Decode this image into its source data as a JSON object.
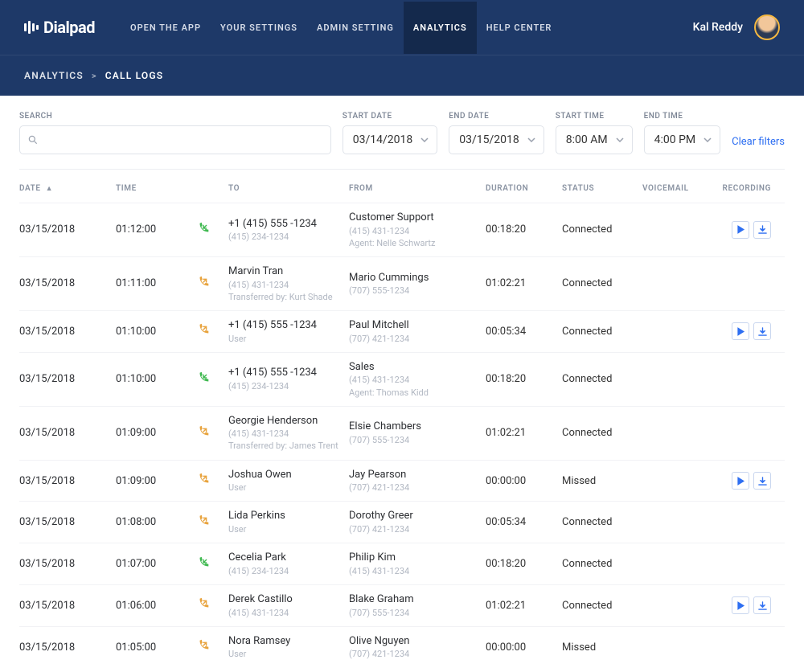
{
  "brand": {
    "name": "Dialpad"
  },
  "nav": {
    "links": [
      {
        "label": "OPEN THE APP"
      },
      {
        "label": "YOUR SETTINGS"
      },
      {
        "label": "ADMIN SETTING"
      },
      {
        "label": "ANALYTICS"
      },
      {
        "label": "HELP CENTER"
      }
    ],
    "active_index": 3
  },
  "user": {
    "name": "Kal Reddy"
  },
  "breadcrumb": {
    "parent": "ANALYTICS",
    "sep": ">",
    "current": "CALL LOGS"
  },
  "filters": {
    "search_label": "SEARCH",
    "search_value": "",
    "start_date_label": "START DATE",
    "start_date": "03/14/2018",
    "end_date_label": "END DATE",
    "end_date": "03/15/2018",
    "start_time_label": "START TIME",
    "start_time": "8:00 AM",
    "end_time_label": "END TIME",
    "end_time": "4:00 PM",
    "clear": "Clear filters"
  },
  "columns": {
    "date": "DATE",
    "time": "TIME",
    "to": "TO",
    "from": "FROM",
    "duration": "DURATION",
    "status": "STATUS",
    "voicemail": "VOICEMAIL",
    "recording": "RECORDING"
  },
  "rows": [
    {
      "date": "03/15/2018",
      "time": "01:12:00",
      "call": "inbound",
      "to_primary": "+1 (415) 555 -1234",
      "to_sub": "(415) 234-1234",
      "to_extra": "",
      "from_primary": "Customer Support",
      "from_sub": "(415) 431-1234",
      "from_extra": "Agent: Nelle Schwartz",
      "duration": "00:18:20",
      "status": "Connected",
      "recording": true
    },
    {
      "date": "03/15/2018",
      "time": "01:11:00",
      "call": "outbound",
      "to_primary": "Marvin Tran",
      "to_sub": "(415) 431-1234",
      "to_extra": "Transferred by: Kurt Shade",
      "from_primary": "Mario Cummings",
      "from_sub": "(707) 555-1234",
      "from_extra": "",
      "duration": "01:02:21",
      "status": "Connected",
      "recording": false
    },
    {
      "date": "03/15/2018",
      "time": "01:10:00",
      "call": "outbound",
      "to_primary": "+1 (415) 555 -1234",
      "to_sub": "User",
      "to_extra": "",
      "from_primary": "Paul Mitchell",
      "from_sub": "(707) 421-1234",
      "from_extra": "",
      "duration": "00:05:34",
      "status": "Connected",
      "recording": true
    },
    {
      "date": "03/15/2018",
      "time": "01:10:00",
      "call": "inbound",
      "to_primary": "+1 (415) 555 -1234",
      "to_sub": "(415) 234-1234",
      "to_extra": "",
      "from_primary": "Sales",
      "from_sub": "(415) 431-1234",
      "from_extra": "Agent: Thomas Kidd",
      "duration": "00:18:20",
      "status": "Connected",
      "recording": false
    },
    {
      "date": "03/15/2018",
      "time": "01:09:00",
      "call": "outbound",
      "to_primary": "Georgie Henderson",
      "to_sub": "(415) 431-1234",
      "to_extra": "Transferred by: James Trent",
      "from_primary": "Elsie Chambers",
      "from_sub": "(707) 555-1234",
      "from_extra": "",
      "duration": "01:02:21",
      "status": "Connected",
      "recording": false
    },
    {
      "date": "03/15/2018",
      "time": "01:09:00",
      "call": "outbound-alt",
      "to_primary": "Joshua Owen",
      "to_sub": "User",
      "to_extra": "",
      "from_primary": "Jay Pearson",
      "from_sub": "(707) 421-1234",
      "from_extra": "",
      "duration": "00:00:00",
      "status": "Missed",
      "recording": true
    },
    {
      "date": "03/15/2018",
      "time": "01:08:00",
      "call": "outbound",
      "to_primary": "Lida Perkins",
      "to_sub": "User",
      "to_extra": "",
      "from_primary": "Dorothy Greer",
      "from_sub": "(707) 421-1234",
      "from_extra": "",
      "duration": "00:05:34",
      "status": "Connected",
      "recording": false
    },
    {
      "date": "03/15/2018",
      "time": "01:07:00",
      "call": "inbound",
      "to_primary": "Cecelia Park",
      "to_sub": "(415) 234-1234",
      "to_extra": "",
      "from_primary": "Philip Kim",
      "from_sub": "(415) 431-1234",
      "from_extra": "",
      "duration": "00:18:20",
      "status": "Connected",
      "recording": false
    },
    {
      "date": "03/15/2018",
      "time": "01:06:00",
      "call": "outbound",
      "to_primary": "Derek Castillo",
      "to_sub": "(415) 431-1234",
      "to_extra": "",
      "from_primary": "Blake Graham",
      "from_sub": "(707) 555-1234",
      "from_extra": "",
      "duration": "01:02:21",
      "status": "Connected",
      "recording": true
    },
    {
      "date": "03/15/2018",
      "time": "01:05:00",
      "call": "outbound-alt",
      "to_primary": "Nora Ramsey",
      "to_sub": "User",
      "to_extra": "",
      "from_primary": "Olive Nguyen",
      "from_sub": "(707) 421-1234",
      "from_extra": "",
      "duration": "00:00:00",
      "status": "Missed",
      "recording": false
    }
  ]
}
